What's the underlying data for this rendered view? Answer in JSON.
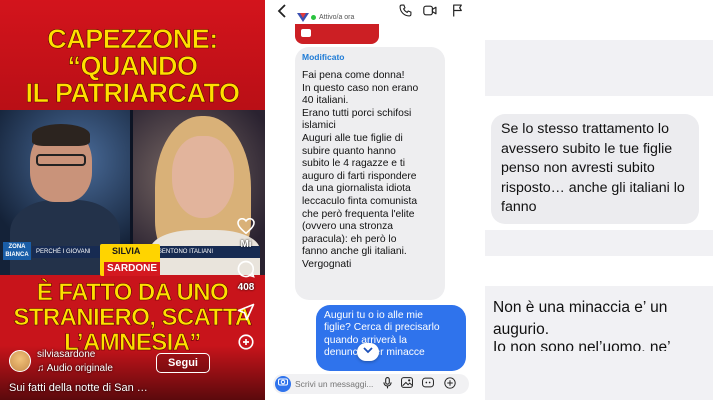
{
  "reel": {
    "headline_top": [
      "CAPEZZONE:",
      "“QUANDO",
      "IL PATRIARCATO"
    ],
    "headline_bottom": [
      "È FATTO DA UNO",
      "STRANIERO, SCATTA",
      "L’AMNESIA”"
    ],
    "channel_badge": "ZONA BIANCA",
    "ticker_left": "PERCHÉ I GIOVANI",
    "ticker_right": "SI SENTONO ITALIANI",
    "guest_first_name": "SILVIA",
    "guest_last_name": "SARDONE",
    "mute_label": "Mi",
    "comment_count": "408",
    "username": "silviasardone",
    "audio_label": "♫ Audio originale",
    "follow_label": "Segui",
    "caption": "Sui fatti della notte di San …",
    "colors": {
      "brand_red": "#c8141b",
      "headline_yellow": "#ffe000"
    }
  },
  "chat": {
    "status": "Attivo/a ora",
    "edited_label": "Modificato",
    "incoming_message": "Fai pena come donna!\nIn questo caso non erano\n40 italiani.\nErano tutti porci schifosi\nislamici\nAuguri alle tue figlie di\nsubire quanto hanno\nsubito le 4 ragazze e ti\nauguro di farti rispondere\nda una giornalista idiota\nleccaculo finta comunista\nche però frequenta l'elite\n(ovvero una stronza\nparacula): eh però lo\nfanno anche gli italiani.\nVergognati",
    "outgoing_message": "Auguri tu o io alle mie\nfiglie? Cerca di precisarlo\nquando arriverà la\ndenuncia per minacce",
    "composer_placeholder": "Scrivi un messaggi...",
    "icons": [
      "back-arrow-icon",
      "phone-icon",
      "video-call-icon",
      "flag-icon",
      "camera-icon",
      "microphone-icon",
      "gallery-icon",
      "sticker-icon",
      "plus-icon",
      "chevron-down-icon"
    ],
    "colors": {
      "outgoing_bubble": "#2f73ec",
      "edited_label": "#1e7bd6"
    }
  },
  "right": {
    "reply_1": "Se lo stesso trattamento lo avessero subito le tue figlie penso non avresti subito risposto… anche gli italiani lo fanno",
    "reply_2": "Non è una minaccia e’ un augurio.",
    "reply_3_partial": "Io non sono nel’uomo, ne’"
  }
}
